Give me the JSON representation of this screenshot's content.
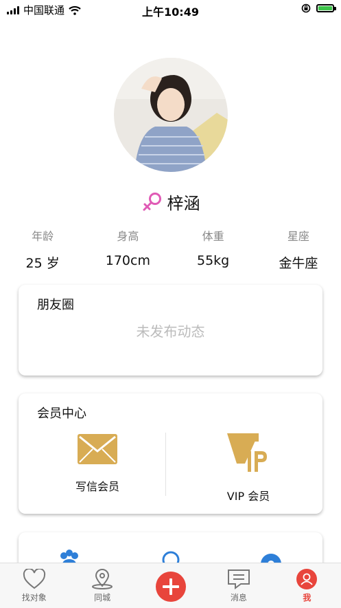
{
  "status_bar": {
    "carrier": "中国联通",
    "time": "上午10:49"
  },
  "profile": {
    "name": "梓涵",
    "gender": "female",
    "stats": [
      {
        "label": "年龄",
        "value": "25 岁"
      },
      {
        "label": "身高",
        "value": "170cm"
      },
      {
        "label": "体重",
        "value": "55kg"
      },
      {
        "label": "星座",
        "value": "金牛座"
      }
    ]
  },
  "moments": {
    "title": "朋友圈",
    "empty_text": "未发布动态"
  },
  "vip_center": {
    "title": "会员中心",
    "items": [
      {
        "label": "写信会员",
        "icon": "envelope-icon"
      },
      {
        "label": "VIP 会员",
        "icon": "vip-icon"
      }
    ]
  },
  "tabbar": {
    "items": [
      {
        "label": "找对象",
        "icon": "heart-icon"
      },
      {
        "label": "同城",
        "icon": "location-pin-icon"
      },
      {
        "label": "",
        "icon": "add-icon"
      },
      {
        "label": "消息",
        "icon": "message-icon"
      },
      {
        "label": "我",
        "icon": "user-icon",
        "active": true
      }
    ]
  },
  "colors": {
    "accent": "#e8453c",
    "gender_female": "#e05ab5",
    "gold": "#d8ac54",
    "battery": "#3dc44a"
  }
}
